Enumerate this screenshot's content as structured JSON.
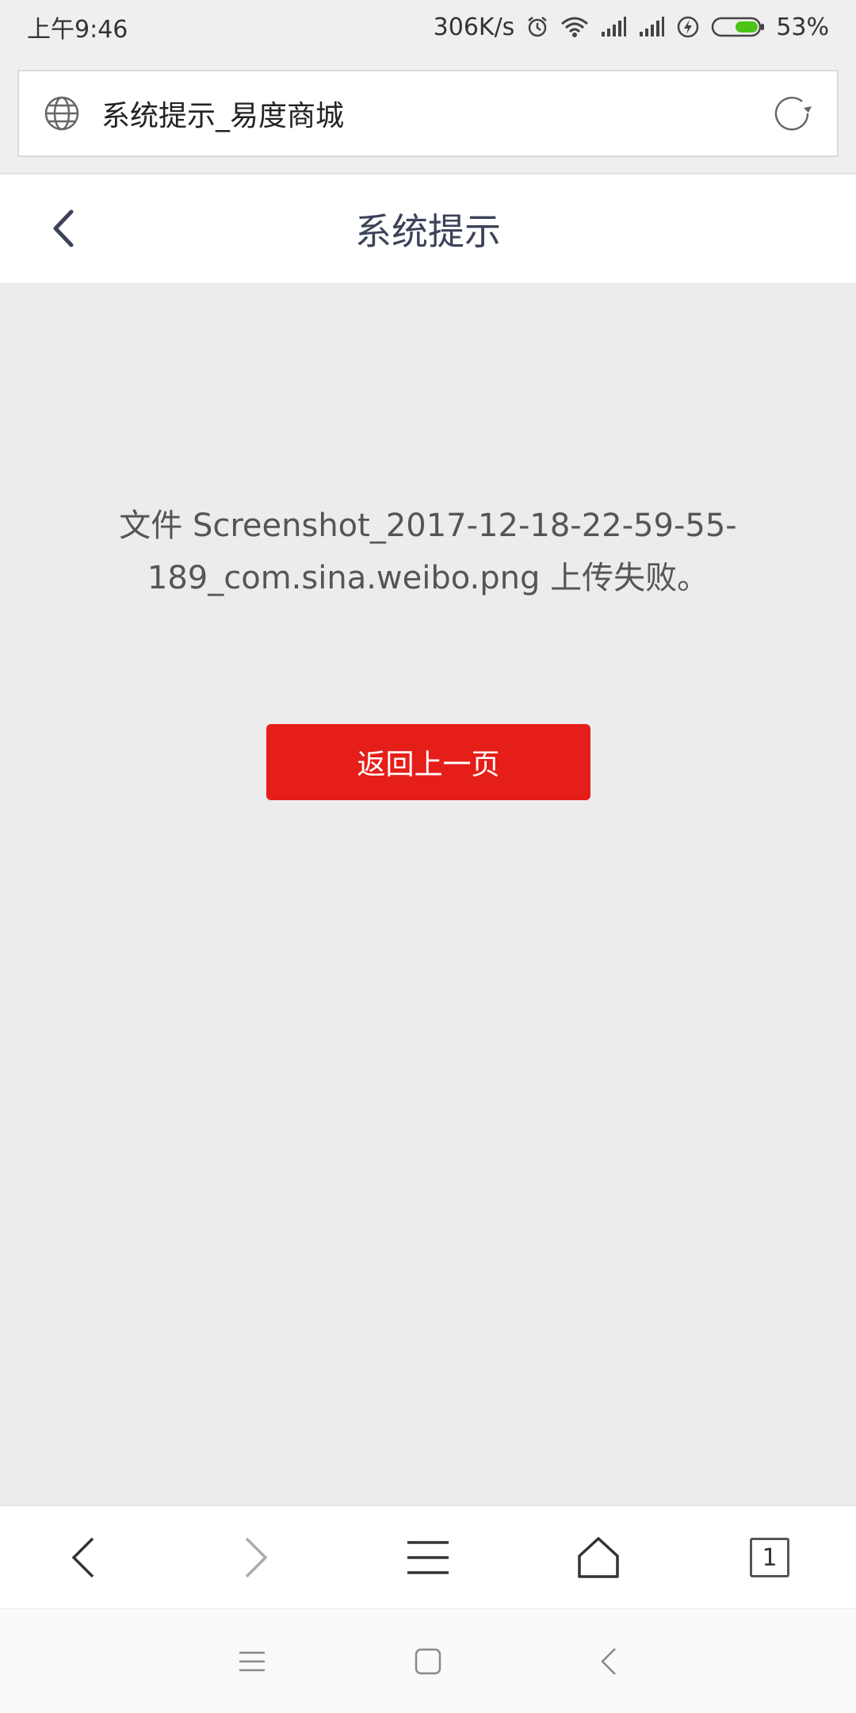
{
  "status_bar": {
    "time": "上午9:46",
    "network_speed": "306K/s",
    "battery_percent": "53%",
    "battery_level": 0.53,
    "icons": [
      "alarm-icon",
      "wifi-icon",
      "signal-icon",
      "signal-icon",
      "charging-icon",
      "battery-icon"
    ]
  },
  "browser": {
    "page_title": "系统提示_易度商城",
    "tab_count": "1"
  },
  "header": {
    "title": "系统提示"
  },
  "main": {
    "message": "文件 Screenshot_2017-12-18-22-59-55-189_com.sina.weibo.png 上传失败。",
    "return_button_label": "返回上一页"
  },
  "colors": {
    "accent": "#e61e1a",
    "header_text": "#3c4258",
    "background": "#ececec",
    "battery_green": "#4cc417"
  }
}
